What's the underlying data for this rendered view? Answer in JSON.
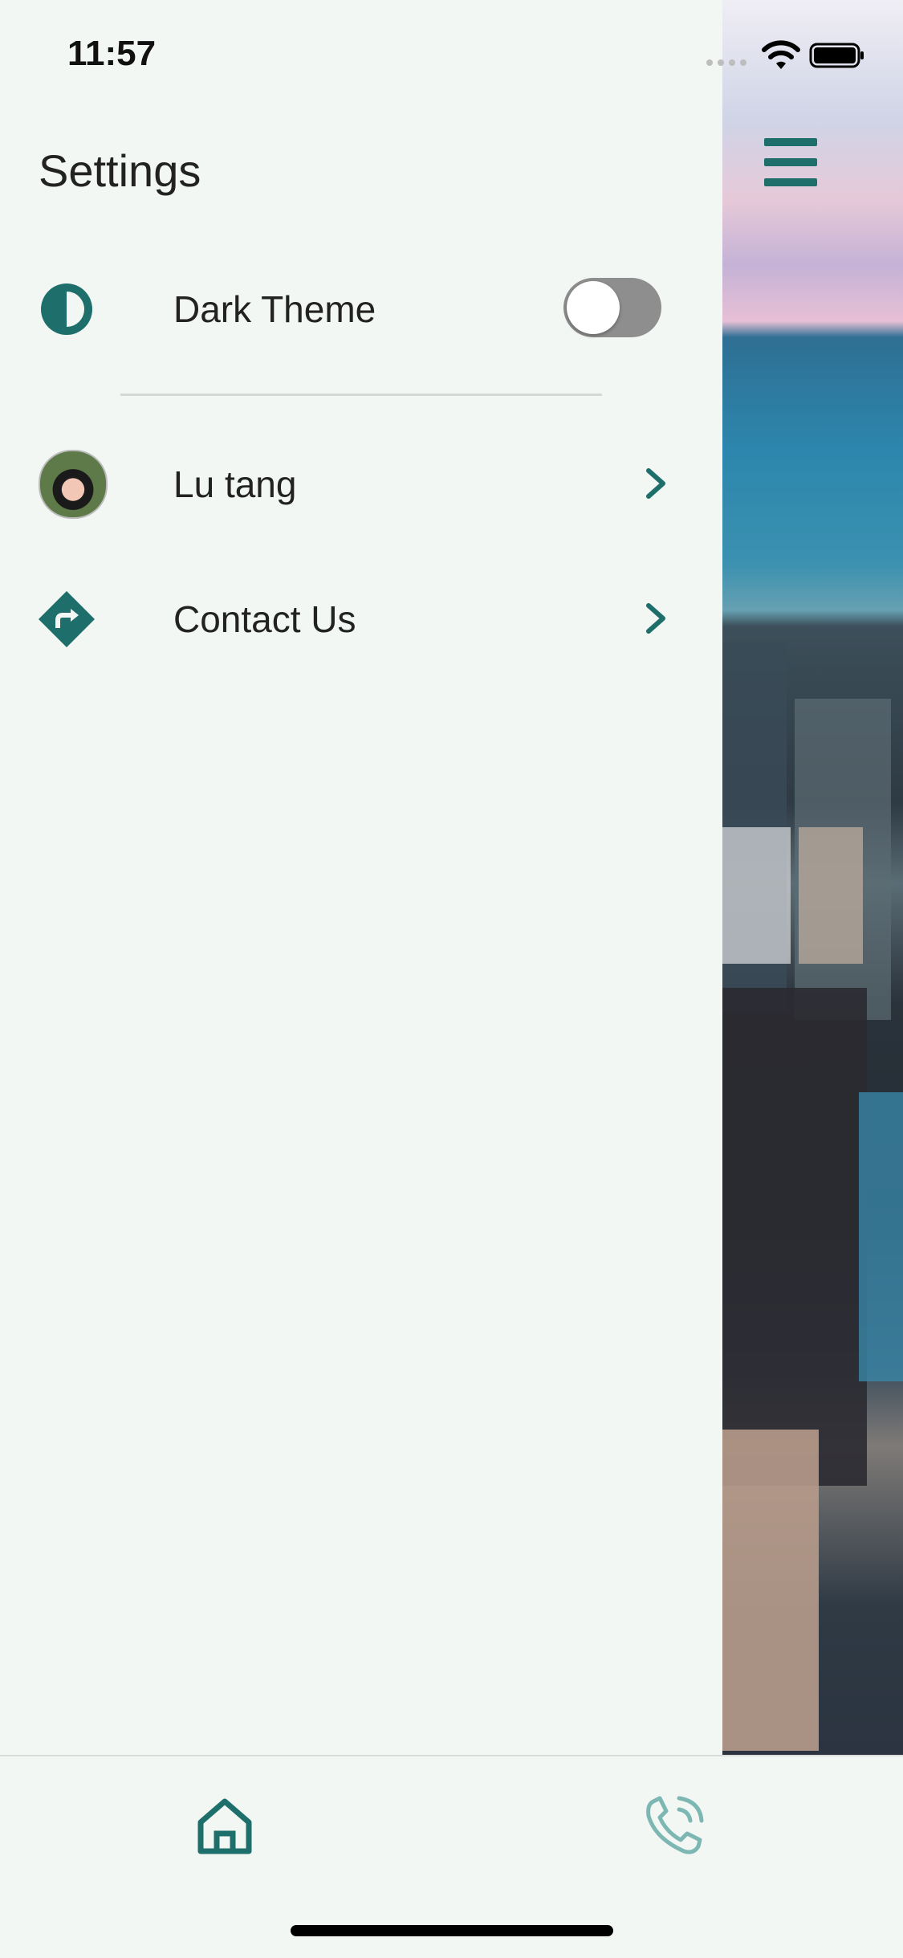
{
  "status_bar": {
    "time": "11:57"
  },
  "drawer": {
    "title": "Settings",
    "items": [
      {
        "label": "Dark Theme",
        "icon": "contrast-icon",
        "toggle_on": false
      },
      {
        "label": "Lu tang",
        "icon": "avatar"
      },
      {
        "label": "Contact Us",
        "icon": "directions-icon"
      }
    ]
  },
  "tabs": [
    {
      "name": "home",
      "icon": "home-icon"
    },
    {
      "name": "call",
      "icon": "phone-call-icon"
    }
  ],
  "colors": {
    "accent": "#1E6F6B",
    "background": "#F3F7F3",
    "toggle_off": "#8E8E8E"
  }
}
